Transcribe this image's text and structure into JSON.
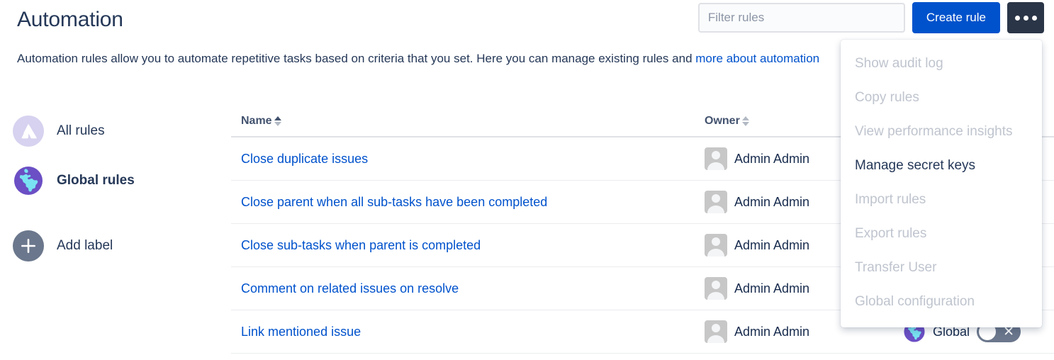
{
  "header": {
    "title": "Automation",
    "filter_placeholder": "Filter rules",
    "filter_value": "",
    "create_label": "Create rule",
    "more_icon": "ellipsis-icon"
  },
  "description": {
    "text": "Automation rules allow you to automate repetitive tasks based on criteria that you set. Here you can manage existing rules and",
    "link_text": "more about automation"
  },
  "sidebar": {
    "items": [
      {
        "label": "All rules",
        "icon": "atlassian-logo-icon",
        "selected": false
      },
      {
        "label": "Global rules",
        "icon": "globe-icon",
        "selected": true
      },
      {
        "label": "Add label",
        "icon": "plus-icon",
        "selected": false
      }
    ]
  },
  "table": {
    "columns": [
      {
        "label": "Name",
        "sort": "asc"
      },
      {
        "label": "Owner",
        "sort": "none"
      }
    ],
    "rows": [
      {
        "name": "Close duplicate issues",
        "owner": "Admin Admin",
        "scope": "",
        "toggle": null
      },
      {
        "name": "Close parent when all sub-tasks have been completed",
        "owner": "Admin Admin",
        "scope": "",
        "toggle": null
      },
      {
        "name": "Close sub-tasks when parent is completed",
        "owner": "Admin Admin",
        "scope": "",
        "toggle": null
      },
      {
        "name": "Comment on related issues on resolve",
        "owner": "Admin Admin",
        "scope": "",
        "toggle": null
      },
      {
        "name": "Link mentioned issue",
        "owner": "Admin Admin",
        "scope": "Global",
        "toggle": "off"
      }
    ]
  },
  "dropdown": {
    "items": [
      {
        "label": "Show audit log",
        "enabled": false
      },
      {
        "label": "Copy rules",
        "enabled": false
      },
      {
        "label": "View performance insights",
        "enabled": false
      },
      {
        "label": "Manage secret keys",
        "enabled": true
      },
      {
        "label": "Import rules",
        "enabled": false
      },
      {
        "label": "Export rules",
        "enabled": false
      },
      {
        "label": "Transfer User",
        "enabled": false
      },
      {
        "label": "Global configuration",
        "enabled": false
      }
    ]
  },
  "colors": {
    "primary_blue": "#0052cc",
    "dark_navy": "#2a3547",
    "link_blue": "#0052cc",
    "text": "#253858",
    "muted": "#bfc4ce",
    "globe_purple": "#6b4fc4",
    "globe_cyan": "#79e2f2"
  }
}
